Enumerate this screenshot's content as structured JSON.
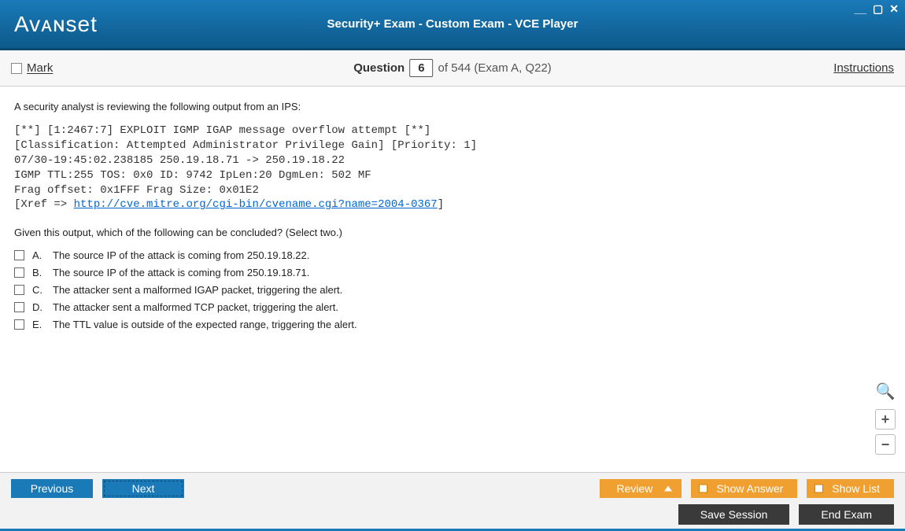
{
  "app": {
    "logo": "Avanset",
    "title": "Security+ Exam - Custom Exam - VCE Player"
  },
  "toolbar": {
    "mark_label": "Mark",
    "question_word": "Question",
    "question_number": "6",
    "question_rest": "of 544 (Exam A, Q22)",
    "instructions": "Instructions"
  },
  "question": {
    "intro": "A security analyst is reviewing the following output from an IPS:",
    "code_line1": "[**] [1:2467:7] EXPLOIT IGMP IGAP message overflow attempt [**]",
    "code_line2": "[Classification: Attempted Administrator Privilege Gain] [Priority: 1]",
    "code_line3": "07/30-19:45:02.238185 250.19.18.71 -> 250.19.18.22",
    "code_line4": "IGMP TTL:255 TOS: 0x0 ID: 9742 IpLen:20 DgmLen: 502 MF",
    "code_line5": "Frag offset: 0x1FFF Frag Size: 0x01E2",
    "code_xref_pre": "[Xref => ",
    "code_xref_link": "http://cve.mitre.org/cgi-bin/cvename.cgi?name=2004-0367",
    "code_xref_post": "]",
    "prompt": "Given this output, which of the following can be concluded? (Select two.)",
    "options": [
      {
        "letter": "A.",
        "text": "The source IP of the attack is coming from 250.19.18.22."
      },
      {
        "letter": "B.",
        "text": "The source IP of the attack is coming from 250.19.18.71."
      },
      {
        "letter": "C.",
        "text": "The attacker sent a malformed IGAP packet, triggering the alert."
      },
      {
        "letter": "D.",
        "text": "The attacker sent a malformed TCP packet, triggering the alert."
      },
      {
        "letter": "E.",
        "text": "The TTL value is outside of the expected range, triggering the alert."
      }
    ]
  },
  "footer": {
    "previous": "Previous",
    "next": "Next",
    "review": "Review",
    "show_answer": "Show Answer",
    "show_list": "Show List",
    "save_session": "Save Session",
    "end_exam": "End Exam"
  }
}
